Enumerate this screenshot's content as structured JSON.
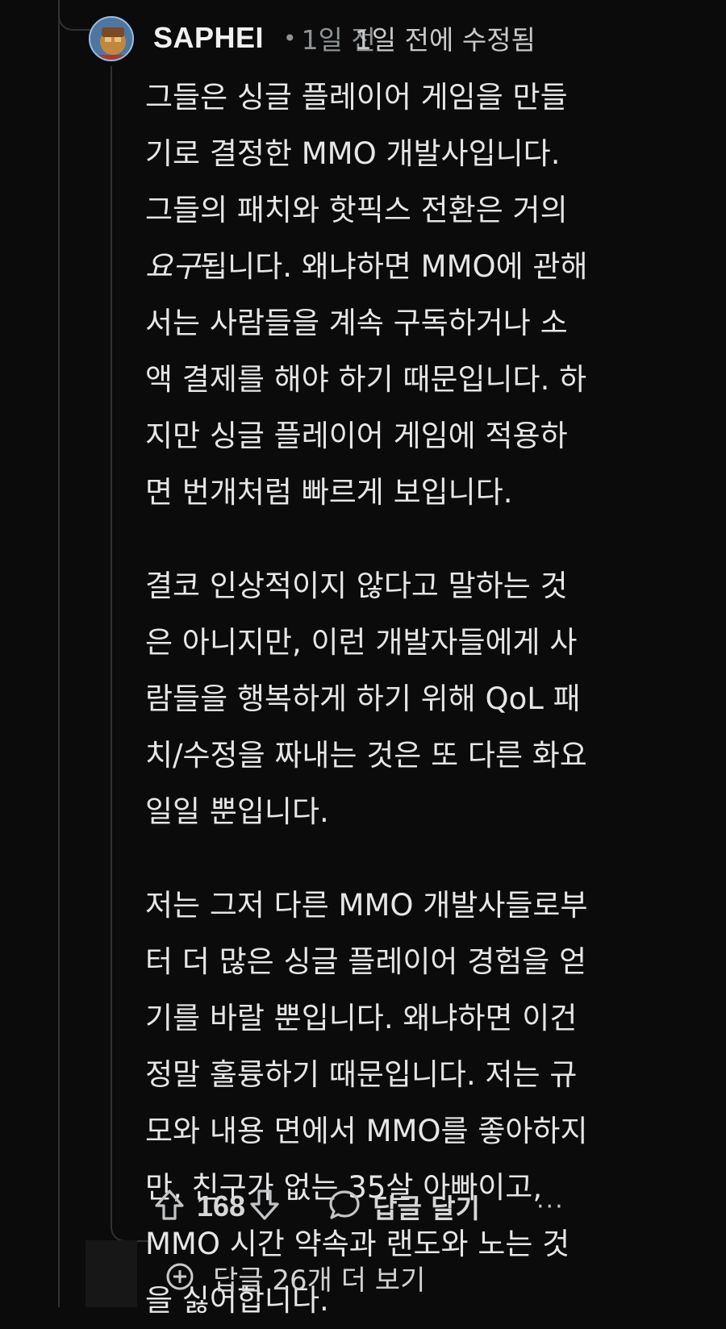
{
  "comment": {
    "username": "SAPHEI",
    "time_ago": "1일 전",
    "edited_label": "1일 전에 수정됨",
    "paragraphs": [
      {
        "lines": [
          "그들은 싱글 플레이어 게임을 만들",
          "기로 결정한 MMO 개발사입니다.",
          "그들의 패치와 핫픽스 전환은 거의",
          "요구됩니다. 왜냐하면 MMO에 관해",
          "서는 사람들을 계속 구독하거나 소",
          "액 결제를 해야 하기 때문입니다. 하",
          "지만 싱글 플레이어 게임에 적용하",
          "면 번개처럼 빠르게 보입니다."
        ]
      },
      {
        "lines": [
          "결코 인상적이지 않다고 말하는 것",
          "은 아니지만, 이런 개발자들에게 사",
          "람들을 행복하게 하기 위해 QoL 패",
          "치/수정을 짜내는 것은 또 다른 화요",
          "일일 뿐입니다."
        ]
      },
      {
        "lines": [
          "저는 그저 다른 MMO 개발사들로부",
          "터 더 많은 싱글 플레이어 경험을 얻",
          "기를 바랄 뿐입니다. 왜냐하면 이건",
          "정말 훌륭하기 때문입니다. 저는 규",
          "모와 내용 면에서 MMO를 좋아하지",
          "만, 친구가 없는 35살 아빠이고,",
          "MMO 시간 약속과 랜도와 노는 것",
          "을 싫어합니다."
        ]
      }
    ],
    "emphasis_word": "요구",
    "score": "168",
    "reply_label": "답글 달기",
    "more_label": "···"
  },
  "more_replies": {
    "label": "답글 26개 더 보기"
  },
  "icons": {
    "upvote": "arrow-up-icon",
    "downvote": "arrow-down-icon",
    "reply": "speech-bubble-icon",
    "more": "ellipsis-icon",
    "expand": "plus-circle-icon"
  },
  "colors": {
    "background": "#0b0b0b",
    "text": "#e6e6e6",
    "muted": "#8e9396",
    "thread_line": "#2f3234"
  }
}
